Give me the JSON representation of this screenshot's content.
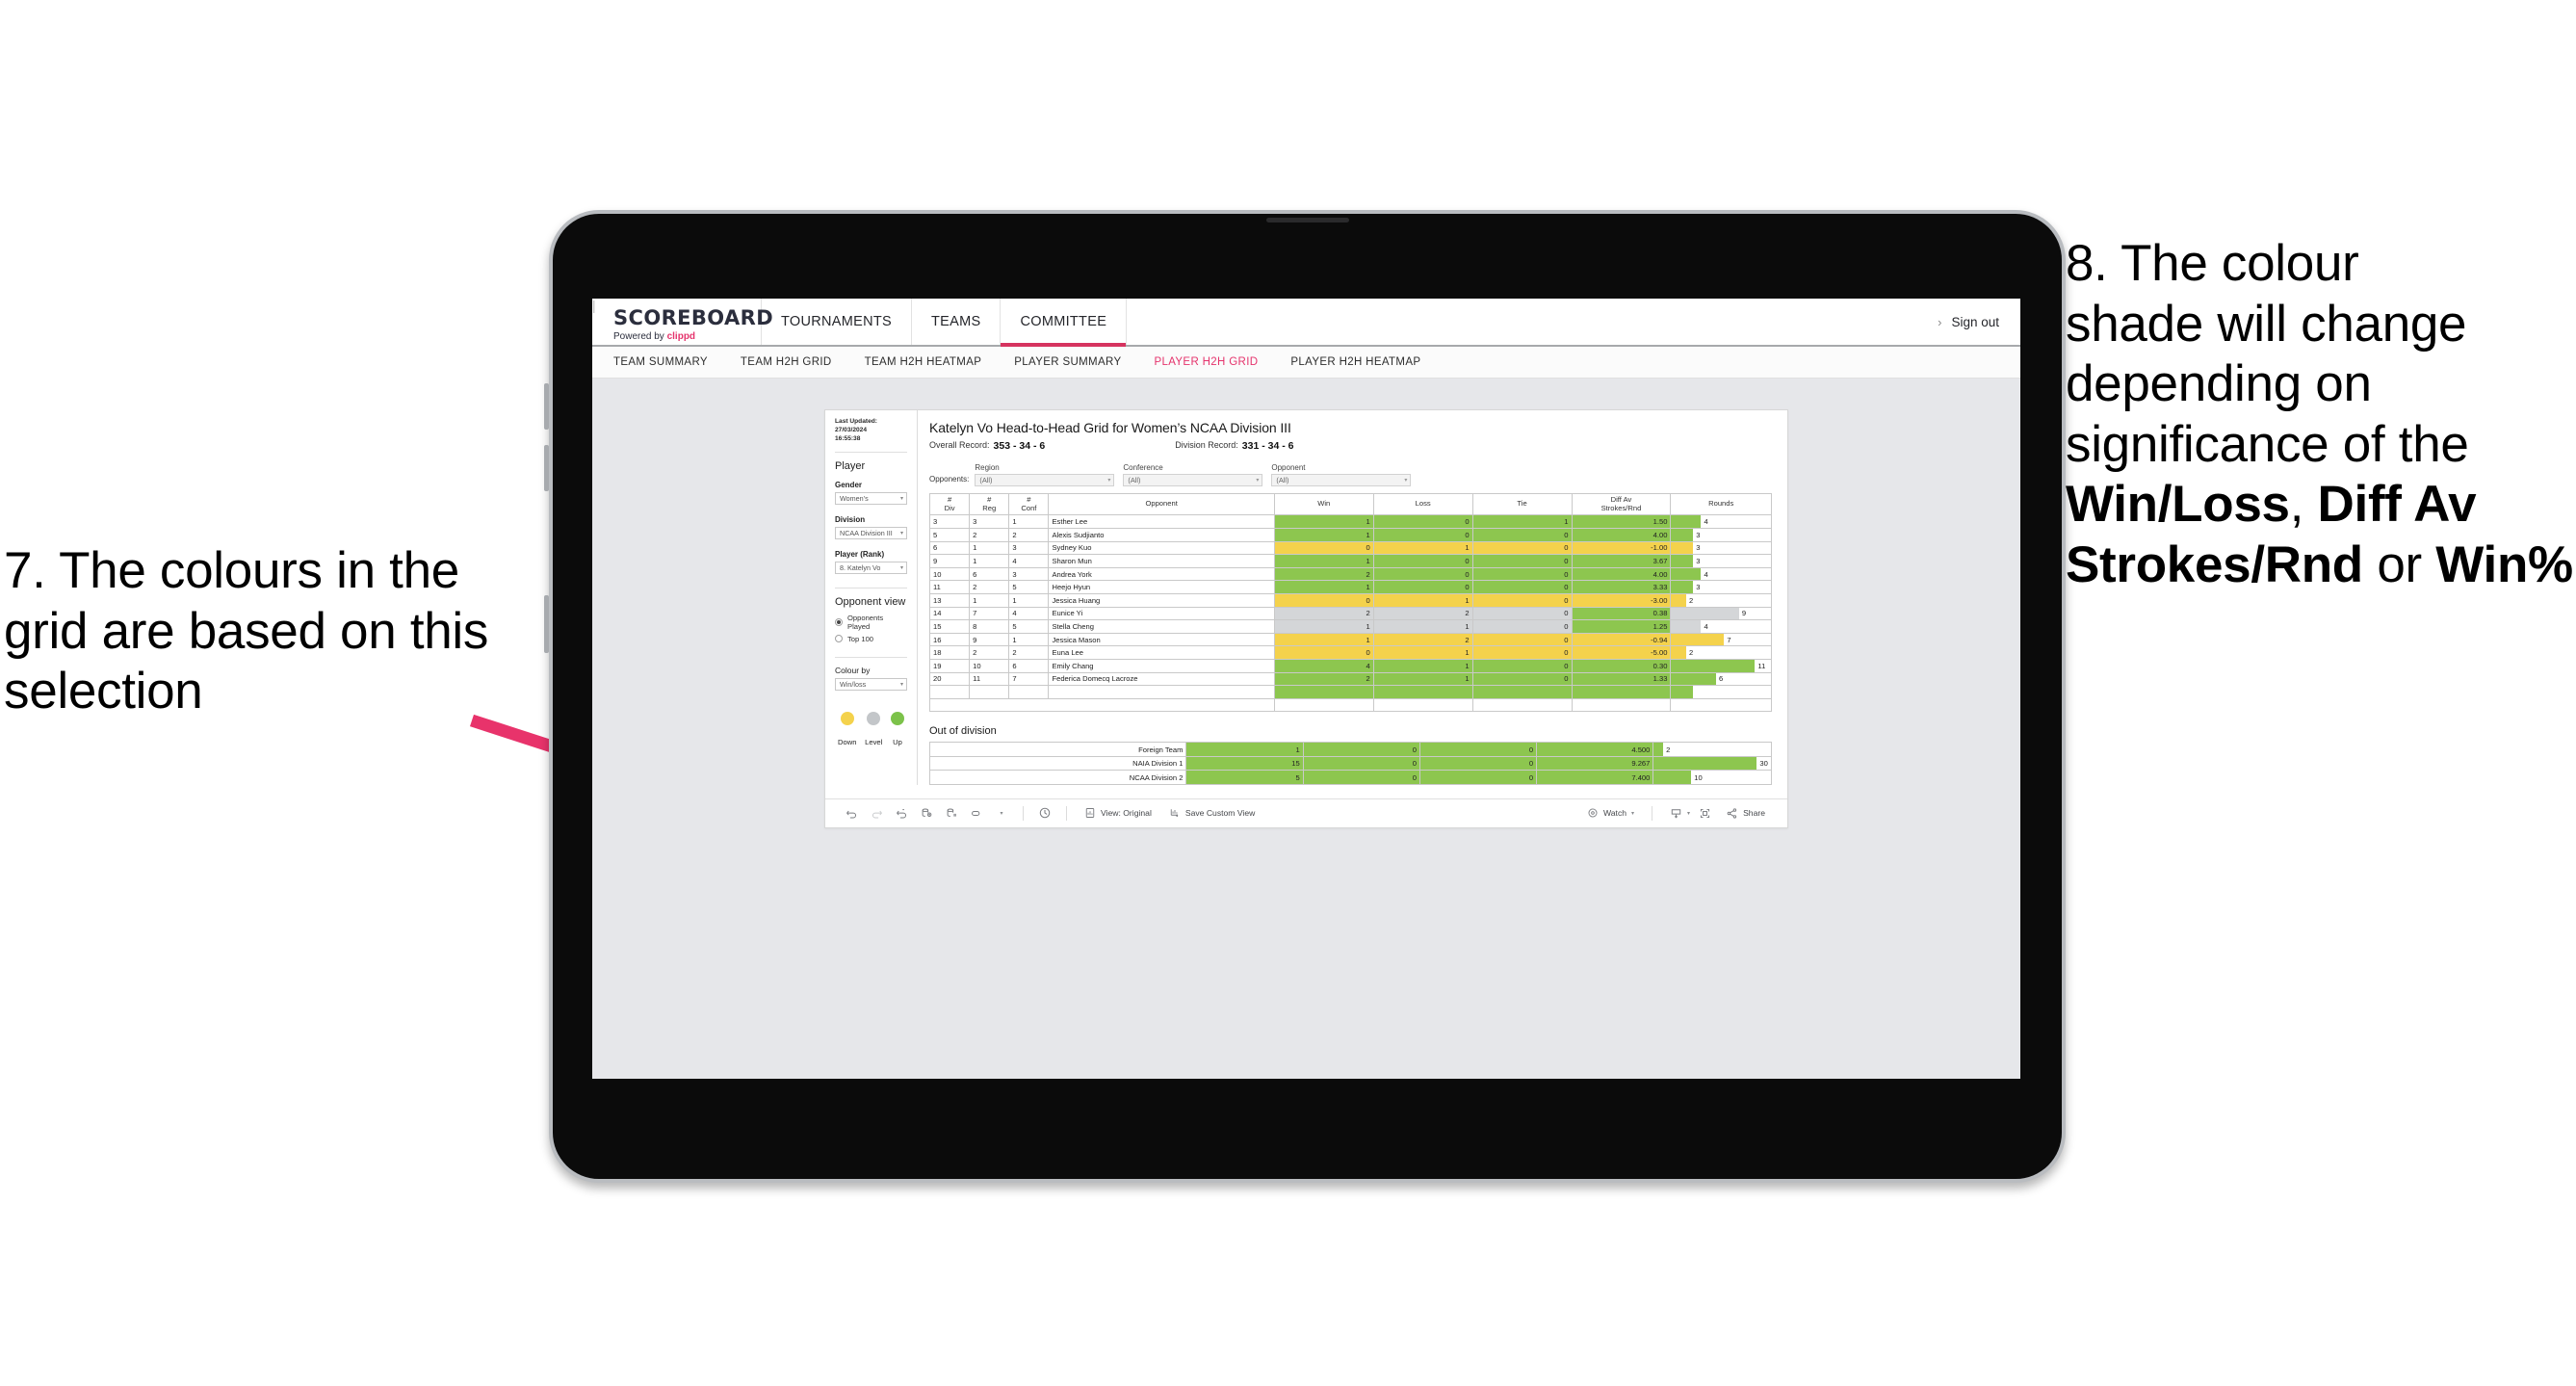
{
  "annotations": {
    "left": {
      "id": "annotation-7",
      "text": "7. The colours in the grid are based on this selection"
    },
    "right": {
      "id": "annotation-8",
      "line1": "8. The colour",
      "line2": "shade will change",
      "line3": "depending on",
      "line4": "significance of the",
      "bold1": "Win/Loss",
      "mid1": ", ",
      "bold2": "Diff Av Strokes/Rnd",
      "mid2": " or ",
      "bold3": "Win%"
    },
    "arrow_color": "#e8336b"
  },
  "topnav": {
    "brand_title": "SCOREBOARD",
    "brand_sub_prefix": "Powered by ",
    "brand_sub_clippd": "clippd",
    "items": [
      {
        "label": "TOURNAMENTS",
        "active": false
      },
      {
        "label": "TEAMS",
        "active": false
      },
      {
        "label": "COMMITTEE",
        "active": true
      }
    ],
    "chevron": "›",
    "divider": "|",
    "signout": "Sign out"
  },
  "subnav": {
    "items": [
      {
        "label": "TEAM SUMMARY",
        "active": false
      },
      {
        "label": "TEAM H2H GRID",
        "active": false
      },
      {
        "label": "TEAM H2H HEATMAP",
        "active": false
      },
      {
        "label": "PLAYER SUMMARY",
        "active": false
      },
      {
        "label": "PLAYER H2H GRID",
        "active": true
      },
      {
        "label": "PLAYER H2H HEATMAP",
        "active": false
      }
    ],
    "active_color": "#e5336c"
  },
  "sidebar": {
    "last_updated_line1": "Last Updated: 27/03/2024",
    "last_updated_line2": "16:55:38",
    "player_section_title": "Player",
    "fields": [
      {
        "label": "Gender",
        "value": "Women’s"
      },
      {
        "label": "Division",
        "value": "NCAA Division III"
      },
      {
        "label": "Player (Rank)",
        "value": "8. Katelyn Vo"
      }
    ],
    "opponent_view_title": "Opponent view",
    "opponent_view_options": [
      {
        "label": "Opponents Played",
        "selected": true
      },
      {
        "label": "Top 100",
        "selected": false
      }
    ],
    "colour_by_label": "Colour by",
    "colour_by_value": "Win/loss",
    "legend": [
      {
        "label": "Down",
        "color": "#f4d24c"
      },
      {
        "label": "Level",
        "color": "#c3c6c9"
      },
      {
        "label": "Up",
        "color": "#7cc24a"
      }
    ]
  },
  "main": {
    "title": "Katelyn Vo Head-to-Head Grid for Women’s NCAA Division III",
    "overall_record_label": "Overall Record:",
    "overall_record_value": "353 -  34 - 6",
    "division_record_label": "Division Record:",
    "division_record_value": "331 -  34 - 6",
    "opponents_label": "Opponents:",
    "filters": [
      {
        "label": "Region",
        "value": "(All)"
      },
      {
        "label": "Conference",
        "value": "(All)"
      },
      {
        "label": "Opponent",
        "value": "(All)"
      }
    ]
  },
  "table": {
    "headers": [
      {
        "l1": "#",
        "l2": "Div"
      },
      {
        "l1": "#",
        "l2": "Reg"
      },
      {
        "l1": "#",
        "l2": "Conf"
      },
      {
        "l1": "Opponent",
        "l2": ""
      },
      {
        "l1": "Win",
        "l2": ""
      },
      {
        "l1": "Loss",
        "l2": ""
      },
      {
        "l1": "Tie",
        "l2": ""
      },
      {
        "l1": "Diff Av",
        "l2": "Strokes/Rnd"
      },
      {
        "l1": "Rounds",
        "l2": ""
      }
    ],
    "rows": [
      {
        "div": "3",
        "reg": "3",
        "conf": "1",
        "opponent": "Esther Lee",
        "win": "1",
        "loss": "0",
        "tie": "1",
        "diff": "1.50",
        "rounds": "4",
        "shade": "#8dc64f",
        "bar_pct": 30
      },
      {
        "div": "5",
        "reg": "2",
        "conf": "2",
        "opponent": "Alexis Sudjianto",
        "win": "1",
        "loss": "0",
        "tie": "0",
        "diff": "4.00",
        "rounds": "3",
        "shade": "#8dc64f",
        "bar_pct": 22
      },
      {
        "div": "6",
        "reg": "1",
        "conf": "3",
        "opponent": "Sydney Kuo",
        "win": "0",
        "loss": "1",
        "tie": "0",
        "diff": "-1.00",
        "rounds": "3",
        "shade": "#f4d24c",
        "bar_pct": 22
      },
      {
        "div": "9",
        "reg": "1",
        "conf": "4",
        "opponent": "Sharon Mun",
        "win": "1",
        "loss": "0",
        "tie": "0",
        "diff": "3.67",
        "rounds": "3",
        "shade": "#8dc64f",
        "bar_pct": 22
      },
      {
        "div": "10",
        "reg": "6",
        "conf": "3",
        "opponent": "Andrea York",
        "win": "2",
        "loss": "0",
        "tie": "0",
        "diff": "4.00",
        "rounds": "4",
        "shade": "#8dc64f",
        "bar_pct": 30
      },
      {
        "div": "11",
        "reg": "2",
        "conf": "5",
        "opponent": "Heejo Hyun",
        "win": "1",
        "loss": "0",
        "tie": "0",
        "diff": "3.33",
        "rounds": "3",
        "shade": "#8dc64f",
        "bar_pct": 22
      },
      {
        "div": "13",
        "reg": "1",
        "conf": "1",
        "opponent": "Jessica Huang",
        "win": "0",
        "loss": "1",
        "tie": "0",
        "diff": "-3.00",
        "rounds": "2",
        "shade": "#f4d24c",
        "bar_pct": 15
      },
      {
        "div": "14",
        "reg": "7",
        "conf": "4",
        "opponent": "Eunice Yi",
        "win": "2",
        "loss": "2",
        "tie": "0",
        "diff": "0.38",
        "rounds": "9",
        "shade": "#d4d6d8",
        "diff_shade": "#8dc64f",
        "bar_pct": 68
      },
      {
        "div": "15",
        "reg": "8",
        "conf": "5",
        "opponent": "Stella Cheng",
        "win": "1",
        "loss": "1",
        "tie": "0",
        "diff": "1.25",
        "rounds": "4",
        "shade": "#d4d6d8",
        "diff_shade": "#8dc64f",
        "bar_pct": 30
      },
      {
        "div": "16",
        "reg": "9",
        "conf": "1",
        "opponent": "Jessica Mason",
        "win": "1",
        "loss": "2",
        "tie": "0",
        "diff": "-0.94",
        "rounds": "7",
        "shade": "#f4d24c",
        "bar_pct": 53
      },
      {
        "div": "18",
        "reg": "2",
        "conf": "2",
        "opponent": "Euna Lee",
        "win": "0",
        "loss": "1",
        "tie": "0",
        "diff": "-5.00",
        "rounds": "2",
        "shade": "#f4d24c",
        "bar_pct": 15
      },
      {
        "div": "19",
        "reg": "10",
        "conf": "6",
        "opponent": "Emily Chang",
        "win": "4",
        "loss": "1",
        "tie": "0",
        "diff": "0.30",
        "rounds": "11",
        "shade": "#8dc64f",
        "bar_pct": 84
      },
      {
        "div": "20",
        "reg": "11",
        "conf": "7",
        "opponent": "Federica Domecq Lacroze",
        "win": "2",
        "loss": "1",
        "tie": "0",
        "diff": "1.33",
        "rounds": "6",
        "shade": "#8dc64f",
        "bar_pct": 45
      }
    ]
  },
  "out_of_division": {
    "title": "Out of division",
    "rows": [
      {
        "name": "Foreign Team",
        "win": "1",
        "loss": "0",
        "tie": "0",
        "diff": "4.500",
        "rounds": "2",
        "shade": "#8dc64f",
        "bar_pct": 8
      },
      {
        "name": "NAIA Division 1",
        "win": "15",
        "loss": "0",
        "tie": "0",
        "diff": "9.267",
        "rounds": "30",
        "shade": "#8dc64f",
        "bar_pct": 88
      },
      {
        "name": "NCAA Division 2",
        "win": "5",
        "loss": "0",
        "tie": "0",
        "diff": "7.400",
        "rounds": "10",
        "shade": "#8dc64f",
        "bar_pct": 32
      }
    ]
  },
  "toolbar": {
    "icons": [
      "undo-icon",
      "redo-icon",
      "revert-icon",
      "refresh-data-icon",
      "pause-updates-icon",
      "highlight-icon"
    ],
    "caret": "▾",
    "view_label": "View: Original",
    "save_label": "Save Custom View",
    "watch_label": "Watch",
    "share_label": "Share"
  }
}
